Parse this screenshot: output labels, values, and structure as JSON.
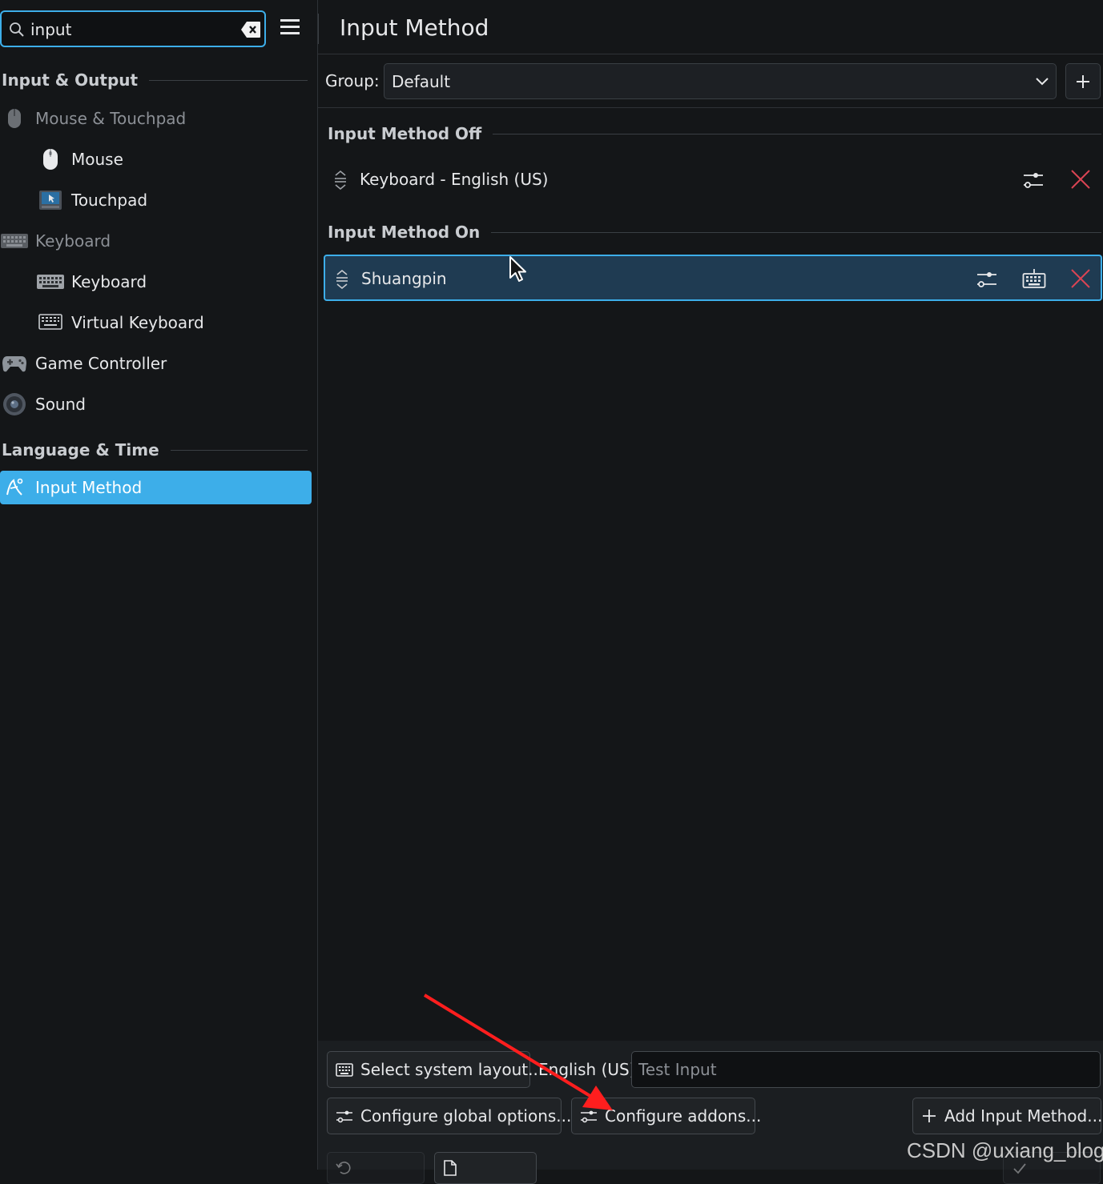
{
  "search": {
    "value": "input"
  },
  "sidebar": {
    "sections": [
      {
        "label": "Input & Output"
      },
      {
        "label": "Language & Time"
      }
    ],
    "items": [
      {
        "label": "Mouse & Touchpad"
      },
      {
        "label": "Mouse"
      },
      {
        "label": "Touchpad"
      },
      {
        "label": "Keyboard"
      },
      {
        "label": "Keyboard"
      },
      {
        "label": "Virtual Keyboard"
      },
      {
        "label": "Game Controller"
      },
      {
        "label": "Sound"
      },
      {
        "label": "Input Method"
      }
    ]
  },
  "header": {
    "title": "Input Method"
  },
  "group": {
    "label": "Group:",
    "value": "Default"
  },
  "input_methods": {
    "off_heading": "Input Method Off",
    "on_heading": "Input Method On",
    "off_item": "Keyboard - English (US)",
    "on_item": "Shuangpin"
  },
  "bottom": {
    "select_layout": "Select system layout...",
    "layout_name": "English (US)",
    "test_placeholder": "Test Input",
    "configure_global": "Configure global options...",
    "configure_addons": "Configure addons...",
    "add_input_method": "Add Input Method..."
  },
  "watermark": "CSDN @uxiang_blog",
  "colors": {
    "accent": "#3daee9",
    "background": "#141618",
    "selected_row": "#1f3b52",
    "remove": "#da4453",
    "annotation_arrow": "#ff1e1e"
  }
}
